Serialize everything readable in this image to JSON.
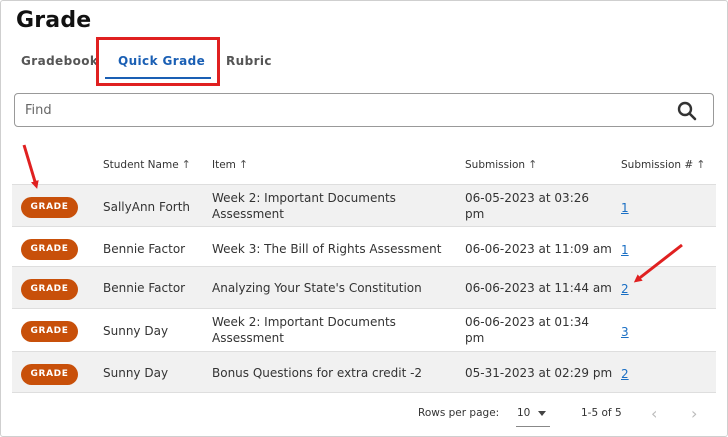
{
  "page": {
    "title": "Grade"
  },
  "tabs": [
    {
      "label": "Gradebook",
      "active": false
    },
    {
      "label": "Quick Grade",
      "active": true
    },
    {
      "label": "Rubric",
      "active": false
    }
  ],
  "search": {
    "placeholder": "Find"
  },
  "table": {
    "columns": [
      {
        "label": "Student Name",
        "sort_icon": "arrow-up"
      },
      {
        "label": "Item",
        "sort_icon": "arrow-up"
      },
      {
        "label": "Submission",
        "sort_icon": "arrow-up"
      },
      {
        "label": "Submission #",
        "sort_icon": "arrow-up"
      }
    ],
    "rows": [
      {
        "button": "GRADE",
        "student": "SallyAnn Forth",
        "item_line1": "Week 2: Important Documents",
        "item_line2": "Assessment",
        "sub_line1": "06-05-2023 at 03:26",
        "sub_line2": "pm",
        "number": "1"
      },
      {
        "button": "GRADE",
        "student": "Bennie Factor",
        "item_line1": "Week 3: The Bill of Rights Assessment",
        "item_line2": "",
        "sub_line1": "06-06-2023 at 11:09 am",
        "sub_line2": "",
        "number": "1"
      },
      {
        "button": "GRADE",
        "student": "Bennie Factor",
        "item_line1": "Analyzing Your State's Constitution",
        "item_line2": "",
        "sub_line1": "06-06-2023 at 11:44 am",
        "sub_line2": "",
        "number": "2"
      },
      {
        "button": "GRADE",
        "student": "Sunny Day",
        "item_line1": "Week 2: Important Documents",
        "item_line2": "Assessment",
        "sub_line1": "06-06-2023 at 01:34",
        "sub_line2": "pm",
        "number": "3"
      },
      {
        "button": "GRADE",
        "student": "Sunny Day",
        "item_line1": "Bonus Questions for extra credit -2",
        "item_line2": "",
        "sub_line1": "05-31-2023 at 02:29 pm",
        "sub_line2": "",
        "number": "2"
      }
    ]
  },
  "footer": {
    "rows_per_page_label": "Rows per page:",
    "rows_per_page_value": "10",
    "range": "1-5 of 5",
    "prev_icon": "chevron-left-icon",
    "next_icon": "chevron-right-icon"
  },
  "colors": {
    "accent": "#1a5fb4",
    "grade_button": "#c8500a",
    "annotation_red": "#e02020",
    "link": "#1a6fc4"
  }
}
